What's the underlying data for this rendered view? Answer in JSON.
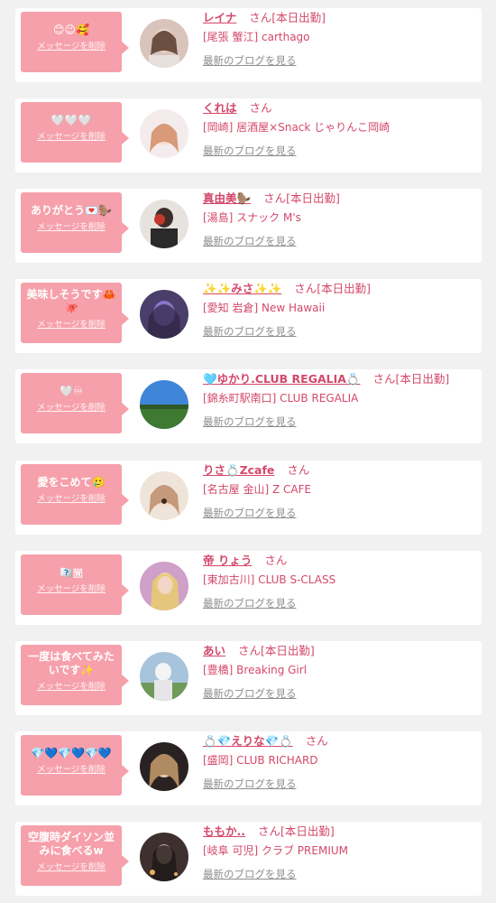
{
  "messages": [
    {
      "message": "😊😉🥰",
      "delete_label": "メッセージを削除",
      "name": "レイナ",
      "honorific": "さん",
      "badge": "[本日出勤]",
      "shop": "[尾張 蟹江] carthago",
      "blog_link": "最新のブログを見る",
      "avatar_color": "#d9c4bc"
    },
    {
      "message": "🤍🤍🤍",
      "delete_label": "メッセージを削除",
      "name": "くれは",
      "honorific": "さん",
      "badge": "",
      "shop": "[岡崎] 居酒屋×Snack じゃりんこ岡崎",
      "blog_link": "最新のブログを見る",
      "avatar_color": "#f2d8cc"
    },
    {
      "message": "ありがとう💌🦫",
      "delete_label": "メッセージを削除",
      "name": "真由美🦫",
      "honorific": "さん",
      "badge": "[本日出勤]",
      "shop": "[湯島] スナック M's",
      "blog_link": "最新のブログを見る",
      "avatar_color": "#5b4a45"
    },
    {
      "message": "美味しそうです🦀\n🐙",
      "delete_label": "メッセージを削除",
      "name": "✨✨みさ✨✨",
      "honorific": "さん",
      "badge": "[本日出勤]",
      "shop": "[愛知 岩倉] New Hawaii",
      "blog_link": "最新のブログを見る",
      "avatar_color": "#5a4a8a"
    },
    {
      "message": "🤍♾",
      "delete_label": "メッセージを削除",
      "name": "🩵ゆかり.CLUB REGALIA💍",
      "honorific": "さん",
      "badge": "[本日出勤]",
      "shop": "[錦糸町駅南口] CLUB REGALIA",
      "blog_link": "最新のブログを見る",
      "avatar_color": "#4f8fd6"
    },
    {
      "message": "愛をこめて🥲",
      "delete_label": "メッセージを削除",
      "name": "りさ💍Zcafe",
      "honorific": "さん",
      "badge": "",
      "shop": "[名古屋 金山] Z CAFE",
      "blog_link": "最新のブログを見る",
      "avatar_color": "#e8c8b0"
    },
    {
      "message": "🇼🇼🇼",
      "delete_label": "メッセージを削除",
      "name": "帝 りょう",
      "honorific": "さん",
      "badge": "",
      "shop": "[東加古川] CLUB S-CLASS",
      "blog_link": "最新のブログを見る",
      "avatar_color": "#d8a0c8"
    },
    {
      "message": "一度は食べてみた\nいです✨",
      "delete_label": "メッセージを削除",
      "name": "あい",
      "honorific": "さん",
      "badge": "[本日出勤]",
      "shop": "[豊橋] Breaking Girl",
      "blog_link": "最新のブログを見る",
      "avatar_color": "#9fb8a0"
    },
    {
      "message": "💎💙💎💙💎💙",
      "delete_label": "メッセージを削除",
      "name": "💍💎えりな💎💍",
      "honorific": "さん",
      "badge": "",
      "shop": "[盛岡] CLUB RICHARD",
      "blog_link": "最新のブログを見る",
      "avatar_color": "#3a3030"
    },
    {
      "message": "空腹時ダイソン並\nみに食べるw",
      "delete_label": "メッセージを削除",
      "name": "ももか..",
      "honorific": "さん",
      "badge": "[本日出勤]",
      "shop": "[岐阜 可児] クラブ PREMIUM",
      "blog_link": "最新のブログを見る",
      "avatar_color": "#4a3a38"
    }
  ]
}
